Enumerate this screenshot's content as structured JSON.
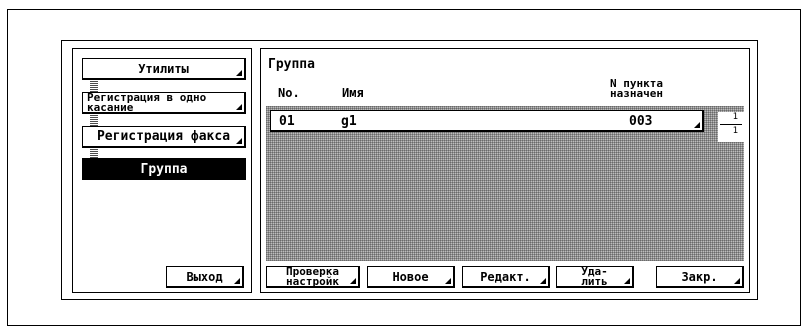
{
  "sidebar": {
    "items": [
      {
        "label": "Утилиты"
      },
      {
        "label_line1": "Регистрация в одно",
        "label_line2": "касание"
      },
      {
        "label": "Регистрация факса"
      },
      {
        "label": "Группа"
      }
    ],
    "exit_label": "Выход"
  },
  "main": {
    "title": "Группа",
    "columns": {
      "no": "No.",
      "name": "Имя",
      "dest_line1": "N пункта",
      "dest_line2": "назначен"
    },
    "rows": [
      {
        "no": "01",
        "name": "g1",
        "dest": "003"
      }
    ],
    "pager": {
      "current": "1",
      "total": "1"
    }
  },
  "toolbar": {
    "check_line1": "Проверка",
    "check_line2": "настройк",
    "new_label": "Новое",
    "edit_label": "Редакт.",
    "delete_line1": "Уда-",
    "delete_line2": "лить",
    "close_label": "Закр."
  }
}
